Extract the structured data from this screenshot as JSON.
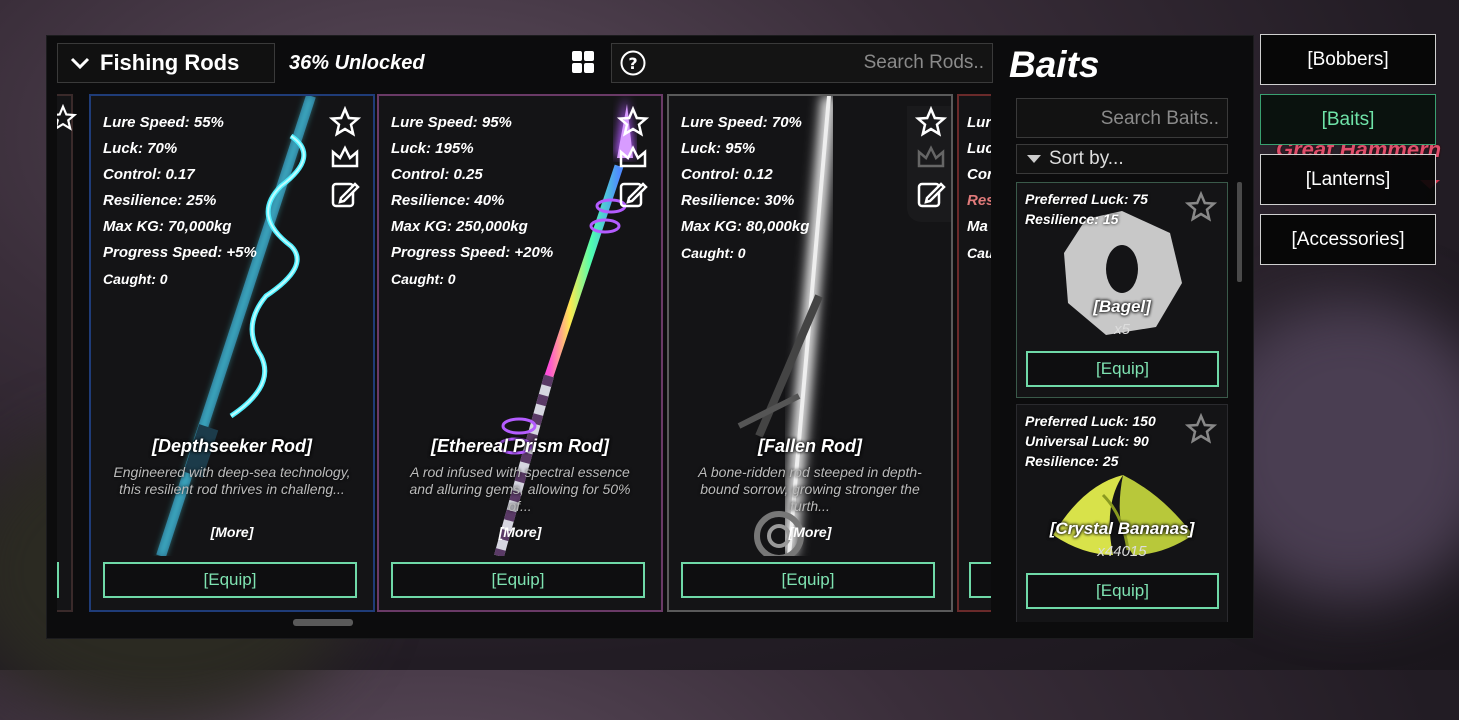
{
  "header": {
    "category": "Fishing Rods",
    "unlocked": "36% Unlocked",
    "search_placeholder": "Search Rods.."
  },
  "rods": [
    {
      "name": "[Depthseeker Rod]",
      "lure": "Lure Speed: 55%",
      "luck": "Luck: 70%",
      "control": "Control: 0.17",
      "resilience": "Resilience: 25%",
      "maxkg": "Max KG: 70,000kg",
      "progress": "Progress Speed: +5%",
      "caught": "Caught: 0",
      "desc": "Engineered with deep-sea technology, this resilient rod thrives in challeng...",
      "more": "[More]",
      "equip": "[Equip]",
      "border": "#1f3c78",
      "glow": "#4ff0ff"
    },
    {
      "name": "[Ethereal Prism Rod]",
      "lure": "Lure Speed: 95%",
      "luck": "Luck: 195%",
      "control": "Control: 0.25",
      "resilience": "Resilience: 40%",
      "maxkg": "Max KG: 250,000kg",
      "progress": "Progress Speed: +20%",
      "caught": "Caught: 0",
      "desc": "A rod infused with spectral essence and alluring gems, allowing for 50% of...",
      "more": "[More]",
      "equip": "[Equip]",
      "border": "#6a3a66",
      "glow": "#b45cff"
    },
    {
      "name": "[Fallen Rod]",
      "lure": "Lure Speed: 70%",
      "luck": "Luck: 95%",
      "control": "Control: 0.12",
      "resilience": "Resilience: 30%",
      "maxkg": "Max KG: 80,000kg",
      "progress": "",
      "caught": "Caught: 0",
      "desc": "A bone-ridden rod steeped in depth-bound sorrow, growing stronger the furth...",
      "more": "[More]",
      "equip": "[Equip]",
      "border": "#5a5a5a",
      "glow": "#ffffff"
    }
  ],
  "partial_right": {
    "lines": [
      "Lur",
      "Luc",
      "Cor",
      "Res",
      "Ma",
      "Cau"
    ]
  },
  "baits_panel": {
    "title": "Baits",
    "search_placeholder": "Search Baits..",
    "sort_label": "Sort by...",
    "items": [
      {
        "stats": [
          "Preferred Luck: 75",
          "Resilience: 15"
        ],
        "name": "[Bagel]",
        "qty": "x5",
        "equip": "[Equip]"
      },
      {
        "stats": [
          "Preferred Luck: 150",
          "Universal Luck: 90",
          "Resilience: 25"
        ],
        "name": "[Crystal Bananas]",
        "qty": "x44015",
        "equip": "[Equip]"
      }
    ]
  },
  "tabs": [
    {
      "label": "[Bobbers]",
      "active": false
    },
    {
      "label": "[Baits]",
      "active": true
    },
    {
      "label": "[Lanterns]",
      "active": false
    },
    {
      "label": "[Accessories]",
      "active": false
    }
  ],
  "world_label": "Great Hammerh"
}
